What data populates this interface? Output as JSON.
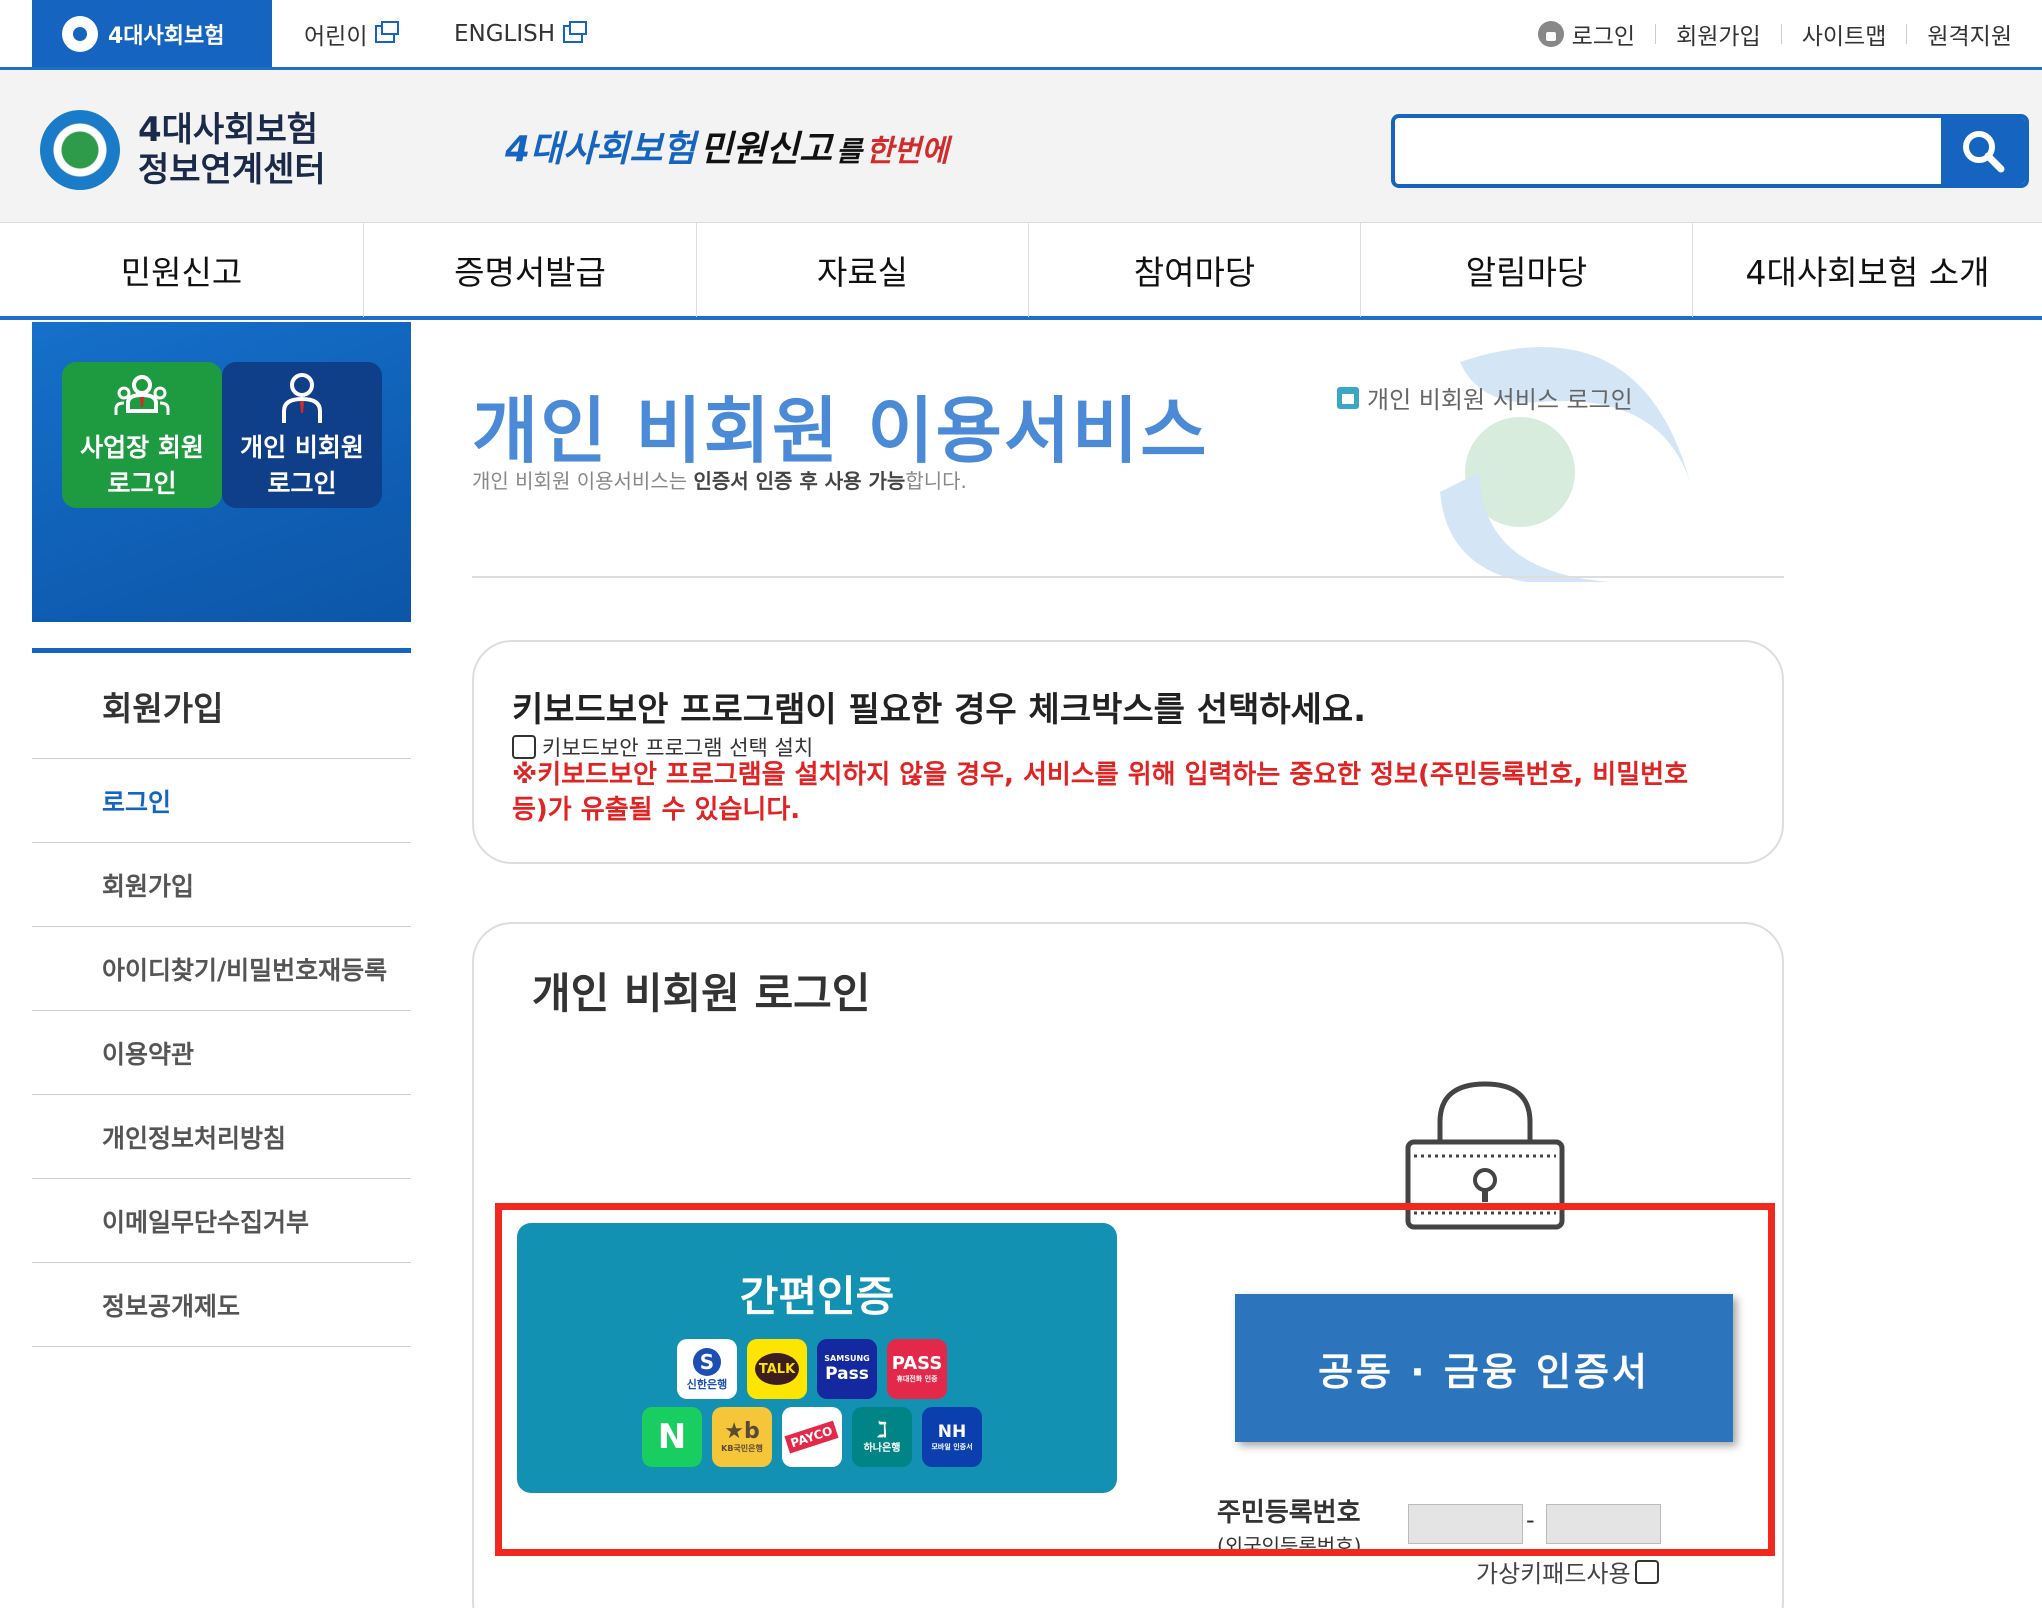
{
  "topbar": {
    "home_tab": "4대사회보험",
    "kids_link": "어린이",
    "english_link": "ENGLISH",
    "login": "로그인",
    "join": "회원가입",
    "sitemap": "사이트맵",
    "remote": "원격지원"
  },
  "header": {
    "brand_line1": "4대사회보험",
    "brand_line2": "정보연계센터",
    "slogan_part1": "4대사회보험",
    "slogan_part2": "민원신고",
    "slogan_part3": "를",
    "slogan_part4": "한번에",
    "search_placeholder": ""
  },
  "gnb": [
    "민원신고",
    "증명서발급",
    "자료실",
    "참여마당",
    "알림마당",
    "4대사회보험 소개"
  ],
  "side": {
    "biz_login_line1": "사업장 회원",
    "biz_login_line2": "로그인",
    "ind_login_line1": "개인 비회원",
    "ind_login_line2": "로그인",
    "menu_title": "회원가입",
    "menu_items": [
      "로그인",
      "회원가입",
      "아이디찾기/비밀번호재등록",
      "이용약관",
      "개인정보처리방침",
      "이메일무단수집거부",
      "정보공개제도"
    ]
  },
  "content": {
    "title": "개인 비회원 이용서비스",
    "desc_prefix": "개인 비회원 이용서비스는 ",
    "desc_bold": "인증서 인증 후 사용 가능",
    "desc_suffix": "합니다.",
    "breadcrumb": "개인 비회원 서비스 로그인"
  },
  "notice": {
    "title": "키보드보안 프로그램이 필요한 경우 체크박스를 선택하세요.",
    "checkbox_label": "키보드보안 프로그램 선택 설치",
    "warning": "※키보드보안 프로그램을 설치하지 않을 경우, 서비스를 위해 입력하는 중요한 정보(주민등록번호, 비밀번호 등)가 유출될 수 있습니다."
  },
  "login": {
    "title": "개인 비회원 로그인",
    "simple_auth_title": "간편인증",
    "apps": {
      "shinhan": "신한은행",
      "kakao": "TALK",
      "samsung_top": "SAMSUNG",
      "samsung_bottom": "Pass",
      "pass_top": "PASS",
      "pass_bottom": "휴대전화 인증",
      "naver": "N",
      "kb": "KB국민은행",
      "payco": "PAYCO",
      "hana": "하나은행",
      "nh_top": "NH",
      "nh_bottom": "모바일 인증서"
    },
    "cert_button": "공동 · 금융 인증서",
    "rrn_label": "주민등록번호",
    "rrn_sub": "(외국인등록번호)",
    "rrn_dash": "-",
    "virtual_keypad": "가상키패드사용"
  },
  "colors": {
    "primary": "#1565c0",
    "simple_auth_bg": "#1291b2",
    "cert_button_bg": "#2c74bb",
    "highlight_border": "#f0281e",
    "warning_text": "#e02424",
    "biz_login_bg": "#1e9a40",
    "ind_login_bg": "#0f3f88"
  },
  "icons": {
    "newwin": "new-window-icon",
    "search": "search-icon",
    "home": "home-icon",
    "padlock": "padlock-icon",
    "lock": "lock-icon"
  }
}
